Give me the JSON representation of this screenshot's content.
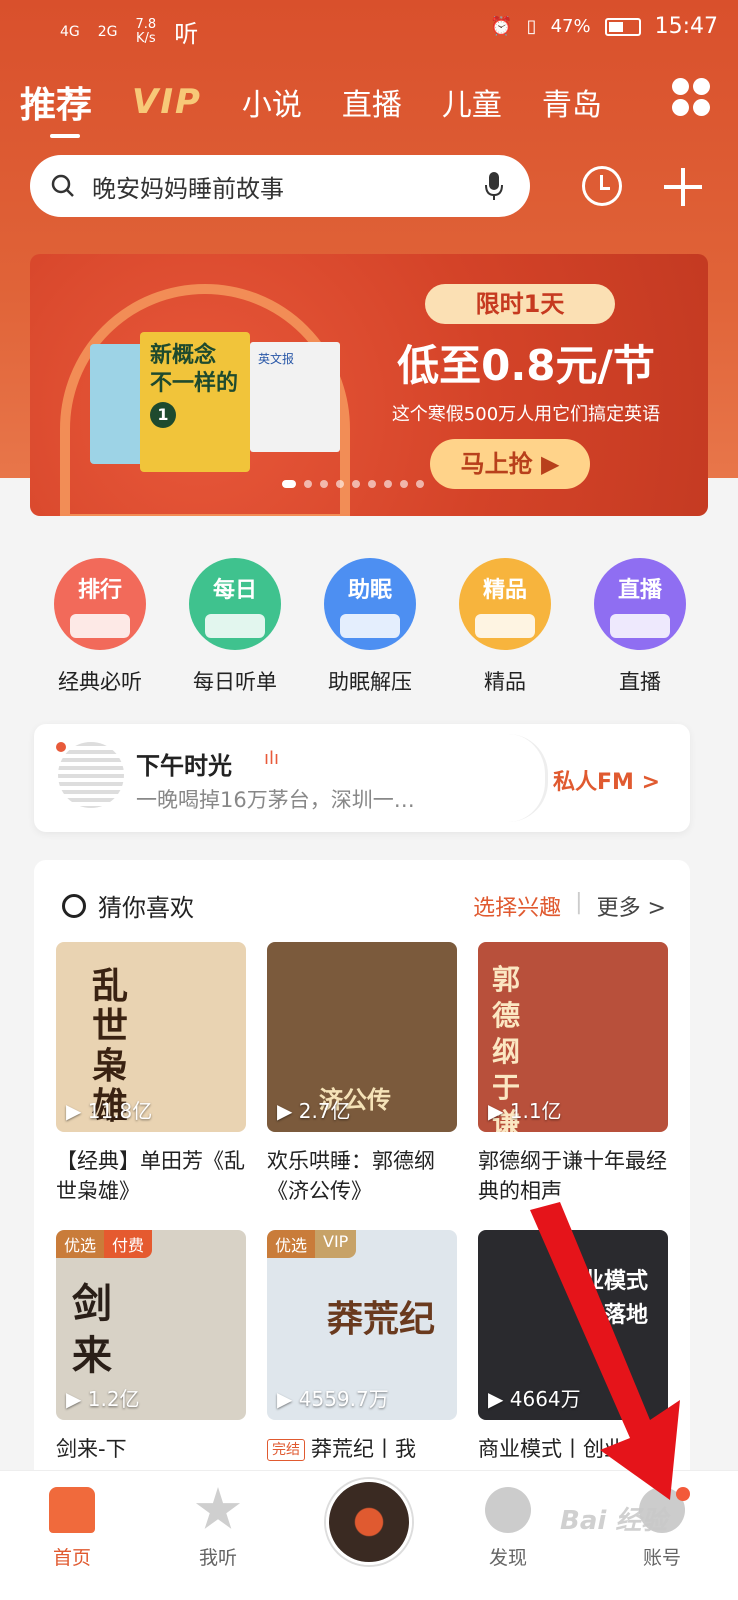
{
  "status_bar": {
    "sig1": "4G",
    "sig2": "2G",
    "speed_value": "7.8",
    "speed_unit": "K/s",
    "listen_icon_text": "听",
    "battery": "47%",
    "time": "15:47"
  },
  "tabs": [
    "推荐",
    "VIP",
    "小说",
    "直播",
    "儿童",
    "青岛"
  ],
  "search": {
    "value": "晚安妈妈睡前故事"
  },
  "banner": {
    "book_title": "新概念 不一样的",
    "book_badge": "1",
    "paper_name": "英文报",
    "limit_label": "限时1天",
    "promo_title": "低至0.8元/节",
    "promo_sub": "这个寒假500万人用它们搞定英语",
    "cta_label": "马上抢"
  },
  "categories": [
    {
      "icon_text": "排行",
      "label": "经典必听",
      "color": "#f26a5a"
    },
    {
      "icon_text": "每日",
      "label": "每日听单",
      "color": "#3fc28e"
    },
    {
      "icon_text": "助眠",
      "label": "助眠解压",
      "color": "#4d8ff2"
    },
    {
      "icon_text": "精品",
      "label": "精品",
      "color": "#f7b43d"
    },
    {
      "icon_text": "直播",
      "label": "直播",
      "color": "#8f6ef2"
    }
  ],
  "fm": {
    "title": "下午时光",
    "subtitle": "一晚喝掉16万茅台，深圳一…",
    "link_label": "私人FM >"
  },
  "guess": {
    "heading": "猜你喜欢",
    "interest_label": "选择兴趣",
    "separator": "|",
    "more_label": "更多 >",
    "items": [
      {
        "plays": "11.8亿",
        "title": "【经典】单田芳《乱世枭雄》",
        "cover_text": "乱世枭雄",
        "bg": "#e9d3b2",
        "badges": [],
        "done": ""
      },
      {
        "plays": "2.7亿",
        "title": "欢乐哄睡：郭德纲《济公传》",
        "cover_text": "济公传",
        "bg": "#7b5a3c",
        "badges": [],
        "done": ""
      },
      {
        "plays": "1.1亿",
        "title": "郭德纲于谦十年最经典的相声",
        "cover_text": "郭德纲 于谦",
        "bg": "#b8503b",
        "badges": [],
        "done": ""
      },
      {
        "plays": "1.2亿",
        "title": "剑来-下",
        "cover_text": "剑来",
        "bg": "#d8d2c6",
        "badges": [
          "优选",
          "付费"
        ],
        "done": ""
      },
      {
        "plays": "4559.7万",
        "title": "莽荒纪丨我",
        "cover_text": "莽荒纪",
        "bg": "#dfe6ec",
        "badges": [
          "优选",
          "VIP"
        ],
        "done": "完结"
      },
      {
        "plays": "4664万",
        "title": "商业模式丨创业实",
        "cover_text": "业模式 时落地",
        "bg": "#2a2a2e",
        "badges": [],
        "done": ""
      }
    ]
  },
  "bottom_nav": {
    "home": "首页",
    "listen": "我听",
    "discover": "发现",
    "account": "账号"
  },
  "watermark": "Bai 经验"
}
